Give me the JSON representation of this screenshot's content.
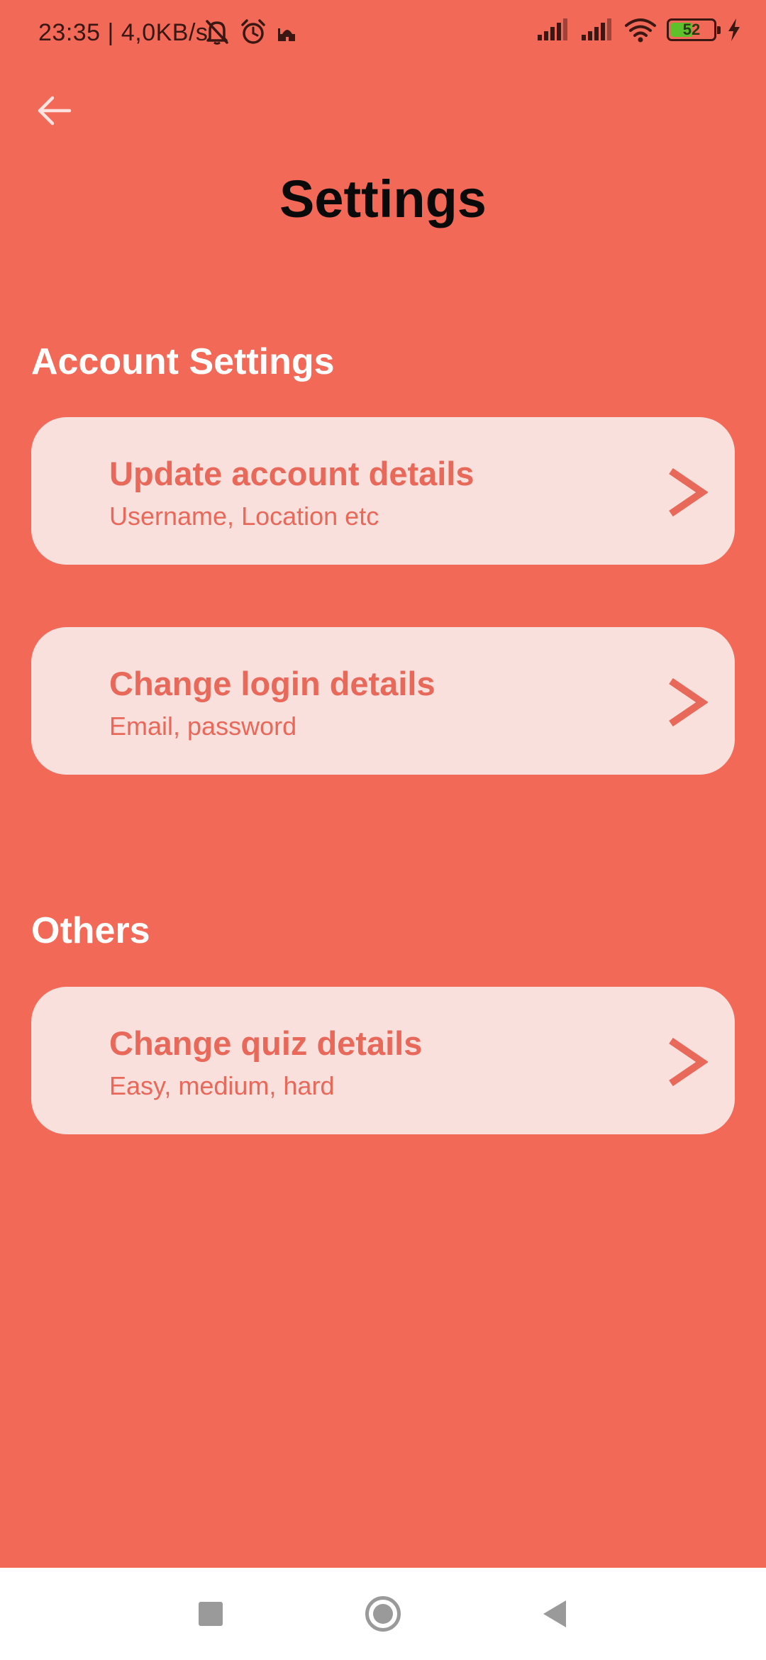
{
  "status_bar": {
    "time": "23:35",
    "network_speed": "4,0KB/s",
    "separator": "|",
    "icons_left": [
      "bell-muted-icon",
      "alarm-clock-icon",
      "mosque-icon"
    ],
    "icons_right": [
      "signal-icon",
      "signal-icon",
      "wifi-icon",
      "battery-icon",
      "charging-bolt-icon"
    ],
    "battery_level": "52",
    "battery_fraction": 0.52
  },
  "header": {
    "back_icon": "arrow-left-icon",
    "title": "Settings"
  },
  "sections": [
    {
      "heading": "Account Settings",
      "items": [
        {
          "title": "Update account details",
          "subtitle": "Username, Location etc",
          "icon": "chevron-right-icon"
        },
        {
          "title": "Change login details",
          "subtitle": "Email, password",
          "icon": "chevron-right-icon"
        }
      ]
    },
    {
      "heading": "Others",
      "items": [
        {
          "title": "Change quiz details",
          "subtitle": "Easy, medium, hard",
          "icon": "chevron-right-icon"
        }
      ]
    }
  ],
  "nav_bar": {
    "buttons": [
      "recent-apps-icon",
      "home-icon",
      "back-triangle-icon"
    ]
  },
  "colors": {
    "background": "#f26958",
    "card": "#fae0dd",
    "card_text": "#e8685a",
    "title": "#0a0a0a",
    "section_heading": "#ffffff",
    "battery_fill": "#5fc12a"
  }
}
